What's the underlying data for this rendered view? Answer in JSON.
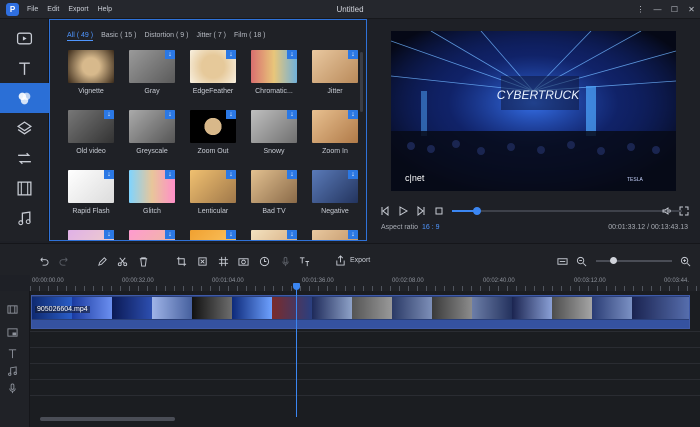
{
  "app": {
    "title": "Untitled",
    "menu": [
      "File",
      "Edit",
      "Export",
      "Help"
    ]
  },
  "rail": {
    "items": [
      "media-icon",
      "text-icon",
      "filters-icon",
      "overlays-icon",
      "transitions-icon",
      "elements-icon",
      "music-icon"
    ],
    "active_index": 2
  },
  "effects": {
    "tabs": [
      "All ( 49 )",
      "Basic ( 15 )",
      "Distortion ( 9 )",
      "Jitter ( 7 )",
      "Film ( 18 )"
    ],
    "active_tab": 0,
    "filters": [
      {
        "label": "Vignette",
        "download": false,
        "style": "vignette"
      },
      {
        "label": "Gray",
        "download": true,
        "style": "gray"
      },
      {
        "label": "EdgeFeather",
        "download": true,
        "style": "edge"
      },
      {
        "label": "Chromatic...",
        "download": true,
        "style": "chromatic"
      },
      {
        "label": "Jitter",
        "download": true,
        "style": "jitter"
      },
      {
        "label": "Old video",
        "download": true,
        "style": "oldvideo"
      },
      {
        "label": "Greyscale",
        "download": true,
        "style": "greyscale"
      },
      {
        "label": "Zoom Out",
        "download": true,
        "style": "zoomout"
      },
      {
        "label": "Snowy",
        "download": true,
        "style": "snowy"
      },
      {
        "label": "Zoom In",
        "download": true,
        "style": "zoomin"
      },
      {
        "label": "Rapid Flash",
        "download": true,
        "style": "flash"
      },
      {
        "label": "Glitch",
        "download": true,
        "style": "glitch"
      },
      {
        "label": "Lenticular",
        "download": true,
        "style": "lenticular"
      },
      {
        "label": "Bad TV",
        "download": true,
        "style": "badtv"
      },
      {
        "label": "Negative",
        "download": true,
        "style": "negative"
      },
      {
        "label": "",
        "download": true,
        "style": "row4a"
      },
      {
        "label": "",
        "download": true,
        "style": "row4b"
      },
      {
        "label": "",
        "download": true,
        "style": "row4c"
      },
      {
        "label": "",
        "download": true,
        "style": "row4d"
      },
      {
        "label": "",
        "download": true,
        "style": "row4e"
      }
    ]
  },
  "preview": {
    "video_text": "CYBERTRUCK",
    "watermark": "c|net",
    "corner_text": "TESLA",
    "aspect_label": "Aspect ratio",
    "aspect_value": "16 : 9",
    "current_time": "00:01:33.12",
    "total_time": "00:13:43.13",
    "time_separator": " / ",
    "progress": 0.11
  },
  "toolbar": {
    "export_label": "Export",
    "zoom_level": 0.22
  },
  "ruler": {
    "labels": [
      "00:00:00.00",
      "00:00:32.00",
      "00:01:04.00",
      "00:01:36.00",
      "00:02:08.00",
      "00:02:40.00",
      "00:03:12.00",
      "00:03:44."
    ]
  },
  "timeline": {
    "clip_name": "905026604.mp4"
  },
  "download_glyph": "↓"
}
